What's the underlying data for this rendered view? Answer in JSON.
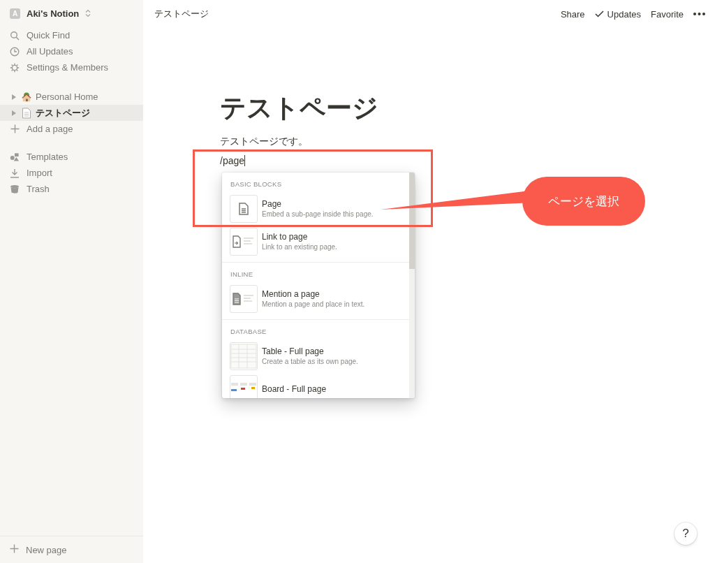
{
  "sidebar": {
    "workspace": {
      "initial": "A",
      "name": "Aki's Notion"
    },
    "nav": [
      {
        "kind": "search",
        "label": "Quick Find"
      },
      {
        "kind": "clock",
        "label": "All Updates"
      },
      {
        "kind": "gear",
        "label": "Settings & Members"
      }
    ],
    "pages": [
      {
        "kind": "house",
        "label": "Personal Home",
        "selected": false
      },
      {
        "kind": "doc",
        "label": "テストページ",
        "selected": true
      }
    ],
    "add_page": "Add a page",
    "tools": [
      {
        "kind": "templates",
        "label": "Templates"
      },
      {
        "kind": "import",
        "label": "Import"
      },
      {
        "kind": "trash",
        "label": "Trash"
      }
    ],
    "new_page": "New page"
  },
  "topbar": {
    "breadcrumb": "テストページ",
    "actions": [
      {
        "kind": "text",
        "label": "Share"
      },
      {
        "kind": "check",
        "label": "Updates"
      },
      {
        "kind": "text",
        "label": "Favorite"
      }
    ]
  },
  "page": {
    "title": "テストページ",
    "paragraph": "テストページです。",
    "command": "/page"
  },
  "menu": {
    "sections": [
      {
        "heading": "BASIC BLOCKS",
        "items": [
          {
            "kind": "page",
            "title": "Page",
            "description": "Embed a sub-page inside this page."
          },
          {
            "kind": "link",
            "title": "Link to page",
            "description": "Link to an existing page."
          }
        ]
      },
      {
        "heading": "INLINE",
        "items": [
          {
            "kind": "mention",
            "title": "Mention a page",
            "description": "Mention a page and place in text."
          }
        ]
      },
      {
        "heading": "DATABASE",
        "items": [
          {
            "kind": "table",
            "title": "Table - Full page",
            "description": "Create a table as its own page."
          },
          {
            "kind": "board",
            "title": "Board - Full page"
          }
        ]
      }
    ]
  },
  "callout": {
    "text": "ページを選択"
  },
  "help": "?"
}
